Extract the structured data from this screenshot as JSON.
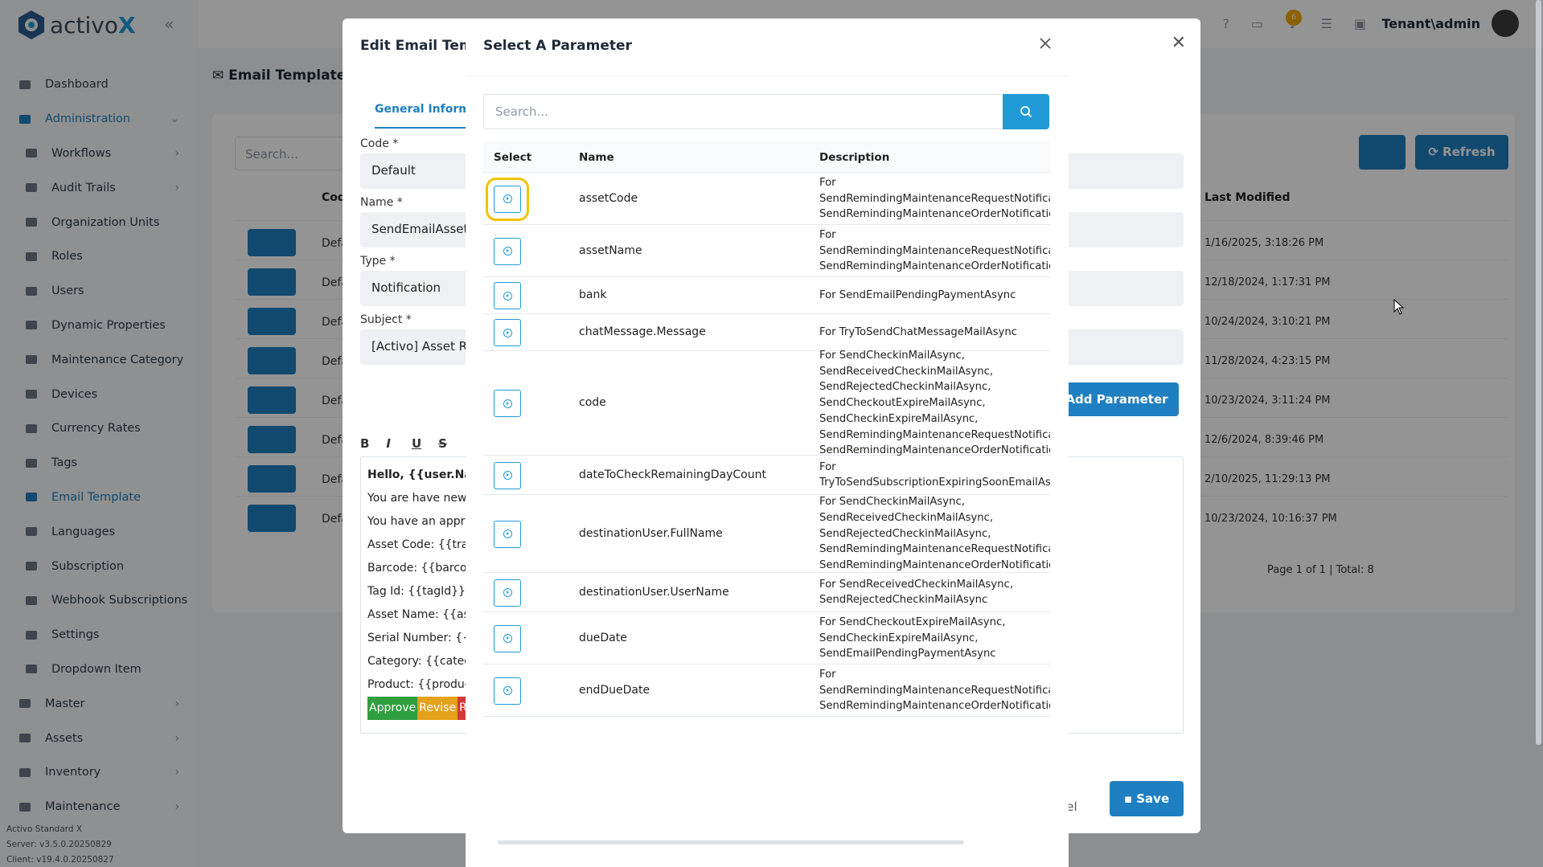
{
  "app": {
    "logo_text_a": "activo",
    "logo_text_b": "X",
    "tenant_user": "Tenant\\admin",
    "notification_count": "6",
    "version_edition": "Activo Standard X",
    "version_server": "Server: v3.5.0.20250829",
    "version_client": "Client: v19.4.0.20250827"
  },
  "sidebar": {
    "items": [
      {
        "label": "Dashboard",
        "icon": "chart-icon"
      },
      {
        "label": "Administration",
        "icon": "cogs-icon"
      },
      {
        "label": "Workflows",
        "icon": "users-icon"
      },
      {
        "label": "Audit Trails",
        "icon": "folder-icon"
      },
      {
        "label": "Organization Units",
        "icon": "sitemap-icon"
      },
      {
        "label": "Roles",
        "icon": "user-icon"
      },
      {
        "label": "Users",
        "icon": "users-icon"
      },
      {
        "label": "Dynamic Properties",
        "icon": "cog-icon"
      },
      {
        "label": "Maintenance Category",
        "icon": "grid-icon"
      },
      {
        "label": "Devices",
        "icon": "printer-icon"
      },
      {
        "label": "Currency Rates",
        "icon": "coins-icon"
      },
      {
        "label": "Tags",
        "icon": "tags-icon"
      },
      {
        "label": "Email Template",
        "icon": "envelope-icon"
      },
      {
        "label": "Languages",
        "icon": "language-icon"
      },
      {
        "label": "Subscription",
        "icon": "refresh-icon"
      },
      {
        "label": "Webhook Subscriptions",
        "icon": "globe-icon"
      },
      {
        "label": "Settings",
        "icon": "cog-icon"
      },
      {
        "label": "Dropdown Item",
        "icon": "tags-icon"
      },
      {
        "label": "Master",
        "icon": "database-icon"
      },
      {
        "label": "Assets",
        "icon": "laptop-icon"
      },
      {
        "label": "Inventory",
        "icon": "box-icon"
      },
      {
        "label": "Maintenance",
        "icon": "tools-icon"
      }
    ]
  },
  "background": {
    "page_title": "Email Template",
    "search_placeholder": "Search...",
    "refresh_label": "Refresh",
    "col_code": "Cod",
    "col_last_modified": "Last Modified",
    "row_code": "Defa",
    "dates": [
      "1/16/2025, 3:18:26 PM",
      "12/18/2024, 1:17:31 PM",
      "10/24/2024, 3:10:21 PM",
      "11/28/2024, 4:23:15 PM",
      "10/23/2024, 3:11:24 PM",
      "12/6/2024, 8:39:46 PM",
      "2/10/2025, 11:29:13 PM",
      "10/23/2024, 10:16:37 PM"
    ],
    "pager": "Page 1 of 1 | Total: 8"
  },
  "edit_modal": {
    "title": "Edit Email Temp",
    "tab_general": "General Informat",
    "code_label": "Code *",
    "code_value": "Default",
    "name_label": "Name *",
    "name_value": "SendEmailAsset",
    "type_label": "Type *",
    "type_value": "Notification",
    "subject_label": "Subject *",
    "subject_value": "[Activo] Asset Re",
    "add_parameter_label": "Add Parameter",
    "cancel_label": "cel",
    "save_label": "Save",
    "editor_lines": [
      "Hello, {{user.Name}",
      "You are have new t",
      "You have an appro",
      "Asset Code: {{trans",
      "Barcode: {{barcode",
      "Tag Id: {{tagId}}",
      "Asset Name: {{asse",
      "Serial Number: {{se",
      "Category: {{catego",
      "Product: {{productI"
    ],
    "editor_approve": "Approve",
    "editor_revise": "Revise",
    "editor_reject": "Re"
  },
  "param_modal": {
    "title": "Select A Parameter",
    "search_placeholder": "Search...",
    "columns": {
      "select": "Select",
      "name": "Name",
      "description": "Description"
    },
    "rows": [
      {
        "name": "assetCode",
        "description": [
          "For",
          "SendRemindingMaintenanceRequestNotification",
          "SendRemindingMaintenanceOrderNotification"
        ]
      },
      {
        "name": "assetName",
        "description": [
          "For",
          "SendRemindingMaintenanceRequestNotification",
          "SendRemindingMaintenanceOrderNotification"
        ]
      },
      {
        "name": "bank",
        "description": [
          "For SendEmailPendingPaymentAsync"
        ]
      },
      {
        "name": "chatMessage.Message",
        "description": [
          "For TryToSendChatMessageMailAsync"
        ]
      },
      {
        "name": "code",
        "description": [
          "For SendCheckinMailAsync,",
          "SendReceivedCheckinMailAsync,",
          "SendRejectedCheckinMailAsync,",
          "SendCheckoutExpireMailAsync,",
          "SendCheckinExpireMailAsync,",
          "SendRemindingMaintenanceRequestNotification",
          "SendRemindingMaintenanceOrderNotification"
        ]
      },
      {
        "name": "dateToCheckRemainingDayCount",
        "description": [
          "For",
          "TryToSendSubscriptionExpiringSoonEmailAsync"
        ]
      },
      {
        "name": "destinationUser.FullName",
        "description": [
          "For SendCheckinMailAsync,",
          "SendReceivedCheckinMailAsync,",
          "SendRejectedCheckinMailAsync,",
          "SendRemindingMaintenanceRequestNotification",
          "SendRemindingMaintenanceOrderNotification"
        ]
      },
      {
        "name": "destinationUser.UserName",
        "description": [
          "For SendReceivedCheckinMailAsync,",
          "SendRejectedCheckinMailAsync"
        ]
      },
      {
        "name": "dueDate",
        "description": [
          "For SendCheckoutExpireMailAsync,",
          "SendCheckinExpireMailAsync,",
          "SendEmailPendingPaymentAsync"
        ]
      },
      {
        "name": "endDueDate",
        "description": [
          "For",
          "SendRemindingMaintenanceRequestNotification",
          "SendRemindingMaintenanceOrderNotification"
        ]
      }
    ]
  },
  "colors": {
    "primary": "#1f7fc0",
    "accent": "#1f9ad6",
    "focus": "#f2c200"
  }
}
